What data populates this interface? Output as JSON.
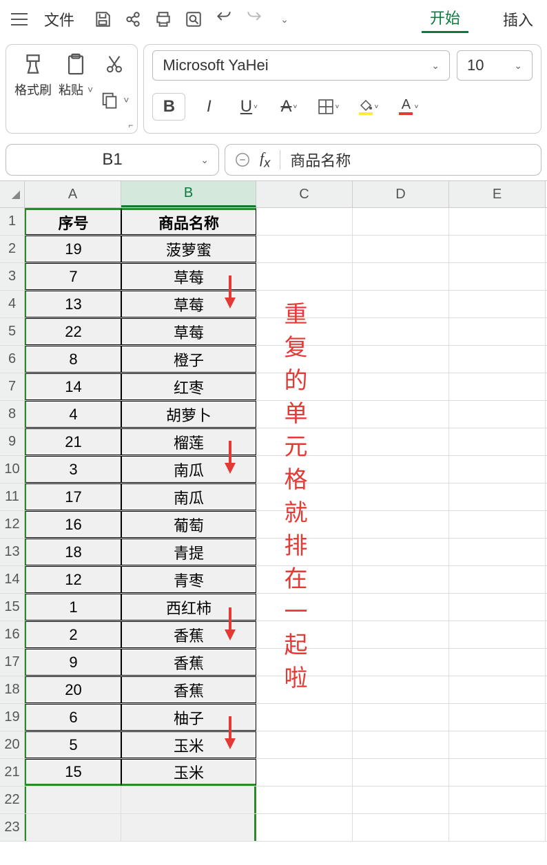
{
  "menu": {
    "file": "文件",
    "start": "开始",
    "insert": "插入"
  },
  "ribbon": {
    "format_brush": "格式刷",
    "paste": "粘贴",
    "font_name": "Microsoft YaHei",
    "font_size": "10"
  },
  "namebox": "B1",
  "formula": "商品名称",
  "columns": [
    "A",
    "B",
    "C",
    "D",
    "E"
  ],
  "table": {
    "headers": {
      "a": "序号",
      "b": "商品名称"
    },
    "rows": [
      {
        "n": "19",
        "name": "菠萝蜜"
      },
      {
        "n": "7",
        "name": "草莓"
      },
      {
        "n": "13",
        "name": "草莓"
      },
      {
        "n": "22",
        "name": "草莓"
      },
      {
        "n": "8",
        "name": "橙子"
      },
      {
        "n": "14",
        "name": "红枣"
      },
      {
        "n": "4",
        "name": "胡萝卜"
      },
      {
        "n": "21",
        "name": "榴莲"
      },
      {
        "n": "3",
        "name": "南瓜"
      },
      {
        "n": "17",
        "name": "南瓜"
      },
      {
        "n": "16",
        "name": "葡萄"
      },
      {
        "n": "18",
        "name": "青提"
      },
      {
        "n": "12",
        "name": "青枣"
      },
      {
        "n": "1",
        "name": "西红柿"
      },
      {
        "n": "2",
        "name": "香蕉"
      },
      {
        "n": "9",
        "name": "香蕉"
      },
      {
        "n": "20",
        "name": "香蕉"
      },
      {
        "n": "6",
        "name": "柚子"
      },
      {
        "n": "5",
        "name": "玉米"
      },
      {
        "n": "15",
        "name": "玉米"
      }
    ]
  },
  "annotation": "重复的单元格就排在一起啦"
}
